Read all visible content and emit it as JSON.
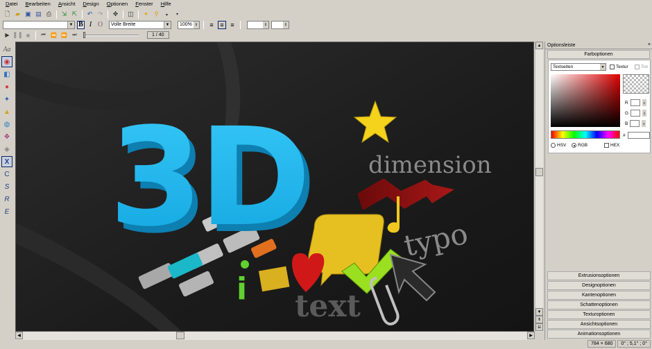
{
  "menu": [
    "Datei",
    "Bearbeiten",
    "Ansicht",
    "Design",
    "Optionen",
    "Fenster",
    "Hilfe"
  ],
  "menu_underline": [
    "D",
    "B",
    "A",
    "D",
    "O",
    "F",
    "H"
  ],
  "toolbar2": {
    "font_value": "",
    "bold": "B",
    "italic": "I",
    "outline": "O",
    "width_value": "Volle Breite",
    "zoom_value": "100%"
  },
  "playback": {
    "frame_counter": "1 / 40"
  },
  "panel": {
    "title": "Optionsleiste",
    "close": "×",
    "header": "Farboptionen",
    "texture_combo": "Textseiten",
    "textur_label": "Textur",
    "ton_label": "Ton",
    "r_label": "R",
    "g_label": "G",
    "b_label": "B",
    "hash": "#",
    "hsv_label": "HSV",
    "rgb_label": "RGB",
    "hex_label": "HEX",
    "sections": [
      "Extrusionsoptionen",
      "Designoptionen",
      "Kantenoptionen",
      "Schattenoptionen",
      "Texturoptionen",
      "Ansichtsoptionen",
      "Animationsoptionen"
    ]
  },
  "canvas_text": {
    "big": "3D",
    "dimension": "dimension",
    "typo": "typo",
    "text": "text",
    "info": "i"
  },
  "status": {
    "size": "784 × 680",
    "angle": "0° ; 5,1° ; 0°"
  },
  "colors": {
    "accent_blue": "#1fb4ee",
    "star_yellow": "#f5d21c",
    "arrow_red": "#8a1010",
    "chrome": "#d4d0c8"
  }
}
